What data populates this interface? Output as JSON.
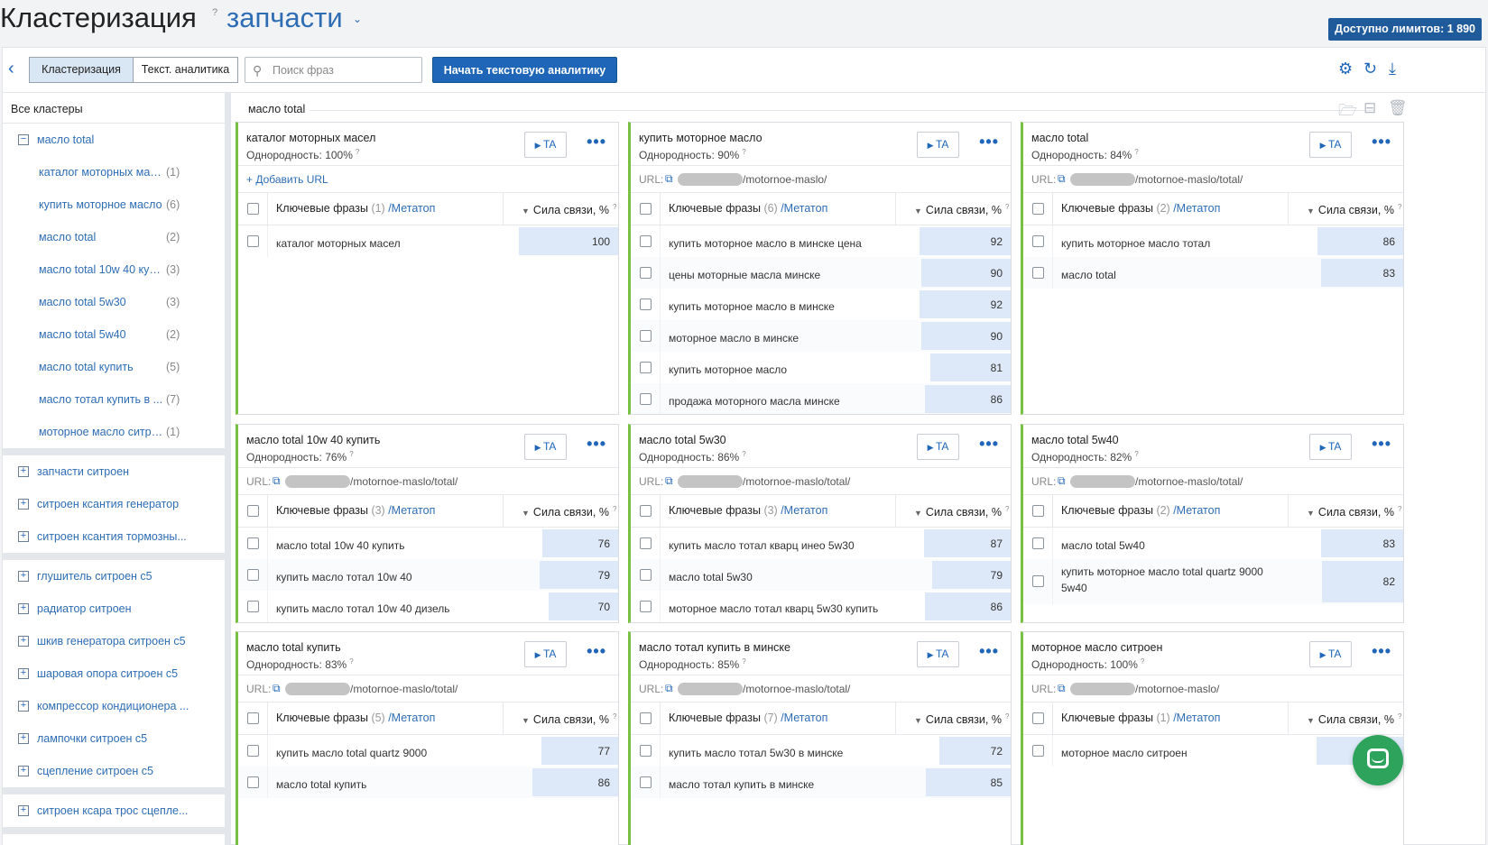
{
  "header": {
    "title": "Кластеризация",
    "title_hint": "?",
    "project": "запчасти",
    "limits": "Доступно лимитов: 1 890"
  },
  "toolbar": {
    "tab_clustering": "Кластеризация",
    "tab_text_analytics": "Текст. аналитика",
    "search_placeholder": "Поиск фраз",
    "start_button": "Начать текстовую аналитику"
  },
  "sidebar": {
    "all_clusters": "Все кластеры",
    "expanded": {
      "label": "масло total",
      "children": [
        {
          "label": "каталог моторных мас...",
          "count": "(1)"
        },
        {
          "label": "купить моторное масло",
          "count": "(6)"
        },
        {
          "label": "масло total",
          "count": "(2)"
        },
        {
          "label": "масло total 10w 40 куп...",
          "count": "(3)"
        },
        {
          "label": "масло total 5w30",
          "count": "(3)"
        },
        {
          "label": "масло total 5w40",
          "count": "(2)"
        },
        {
          "label": "масло total купить",
          "count": "(5)"
        },
        {
          "label": "масло тотал купить в ...",
          "count": "(7)"
        },
        {
          "label": "моторное масло ситро...",
          "count": "(1)"
        }
      ]
    },
    "group2": [
      "запчасти ситроен",
      "ситроен ксантия генератор",
      "ситроен ксантия тормозны..."
    ],
    "group3": [
      "глушитель ситроен с5",
      "радиатор ситроен",
      "шкив генератора ситроен с5",
      "шаровая опора ситроен с5",
      "компрессор кондиционера ...",
      "лампочки ситроен с5",
      "сцепление ситроен с5"
    ],
    "group4": [
      "ситроен ксара трос сцепле..."
    ]
  },
  "main": {
    "breadcrumb": "масло total",
    "labels": {
      "homogeneity": "Однородность:",
      "url": "URL:",
      "add_url": "+ Добавить URL",
      "keywords": "Ключевые фразы",
      "metatop": "/Метатоп",
      "strength": "Сила связи, %",
      "ta": "TA"
    },
    "cards": [
      {
        "title": "каталог моторных масел",
        "homogeneity": "100%",
        "url": null,
        "count": "(1)",
        "rows": [
          {
            "phrase": "каталог моторных масел",
            "value": 100
          }
        ]
      },
      {
        "title": "купить моторное масло",
        "homogeneity": "90%",
        "url": "/motornoe-maslo/",
        "count": "(6)",
        "rows": [
          {
            "phrase": "купить моторное масло в минске цена",
            "value": 92
          },
          {
            "phrase": "цены моторные масла минске",
            "value": 90
          },
          {
            "phrase": "купить моторное масло в минске",
            "value": 92
          },
          {
            "phrase": "моторное масло в минске",
            "value": 90
          },
          {
            "phrase": "купить моторное масло",
            "value": 81
          },
          {
            "phrase": "продажа моторного масла минске",
            "value": 86
          }
        ]
      },
      {
        "title": "масло total",
        "homogeneity": "84%",
        "url": "/motornoe-maslo/total/",
        "count": "(2)",
        "rows": [
          {
            "phrase": "купить моторное масло тотал",
            "value": 86
          },
          {
            "phrase": "масло total",
            "value": 83
          }
        ]
      },
      {
        "title": "масло total 10w 40 купить",
        "homogeneity": "76%",
        "url": "/motornoe-maslo/total/",
        "count": "(3)",
        "rows": [
          {
            "phrase": "масло total 10w 40 купить",
            "value": 76
          },
          {
            "phrase": "купить масло тотал 10w 40",
            "value": 79
          },
          {
            "phrase": "купить масло тотал 10w 40 дизель",
            "value": 70
          }
        ]
      },
      {
        "title": "масло total 5w30",
        "homogeneity": "86%",
        "url": "/motornoe-maslo/total/",
        "count": "(3)",
        "rows": [
          {
            "phrase": "купить масло тотал кварц инео 5w30",
            "value": 87
          },
          {
            "phrase": "масло total 5w30",
            "value": 79
          },
          {
            "phrase": "моторное масло тотал кварц 5w30 купить",
            "value": 86
          }
        ]
      },
      {
        "title": "масло total 5w40",
        "homogeneity": "82%",
        "url": "/motornoe-maslo/total/",
        "count": "(2)",
        "rows": [
          {
            "phrase": "масло total 5w40",
            "value": 83
          },
          {
            "phrase": "купить моторное масло total quartz 9000 5w40",
            "value": 82
          }
        ]
      },
      {
        "title": "масло total купить",
        "homogeneity": "83%",
        "url": "/motornoe-maslo/total/",
        "count": "(5)",
        "rows": [
          {
            "phrase": "купить масло total quartz 9000",
            "value": 77
          },
          {
            "phrase": "масло total купить",
            "value": 86
          }
        ]
      },
      {
        "title": "масло тотал купить в минске",
        "homogeneity": "85%",
        "url": "/motornoe-maslo/total/",
        "count": "(7)",
        "rows": [
          {
            "phrase": "купить масло тотал 5w30 в минске",
            "value": 72
          },
          {
            "phrase": "масло тотал купить в минске",
            "value": 85
          }
        ]
      },
      {
        "title": "моторное масло ситроен",
        "homogeneity": "100%",
        "url": "/motornoe-maslo/",
        "count": "(1)",
        "rows": [
          {
            "phrase": "моторное масло ситроен",
            "value": null
          }
        ]
      }
    ]
  },
  "colors": {
    "accent": "#1f66b8",
    "card_border": "#79c143",
    "bar": "#dde8f8"
  },
  "icons": [
    "back-icon",
    "search-icon",
    "gear-icon",
    "refresh-icon",
    "download-icon",
    "add-folder-icon",
    "collapse-icon",
    "trash-icon",
    "external-link-icon",
    "play-icon",
    "more-icon",
    "chat-icon"
  ]
}
